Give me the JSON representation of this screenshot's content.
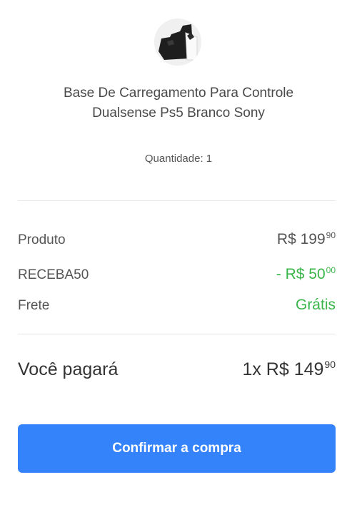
{
  "product": {
    "title": "Base De Carregamento Para Controle Dualsense Ps5 Branco Sony",
    "quantity_label": "Quantidade: 1",
    "thumbnail_icon": "charging-dock-image"
  },
  "summary": {
    "product_label": "Produto",
    "product_price_whole": "R$ 199",
    "product_price_cents": "90",
    "coupon_label": "RECEBA50",
    "coupon_discount_whole": "- R$ 50",
    "coupon_discount_cents": "00",
    "shipping_label": "Frete",
    "shipping_value": "Grátis"
  },
  "total": {
    "label": "Você pagará",
    "amount_whole": "1x R$ 149",
    "amount_cents": "90"
  },
  "actions": {
    "confirm_label": "Confirmar a compra"
  },
  "colors": {
    "accent": "#3483fa",
    "discount_green": "#39b54a"
  }
}
